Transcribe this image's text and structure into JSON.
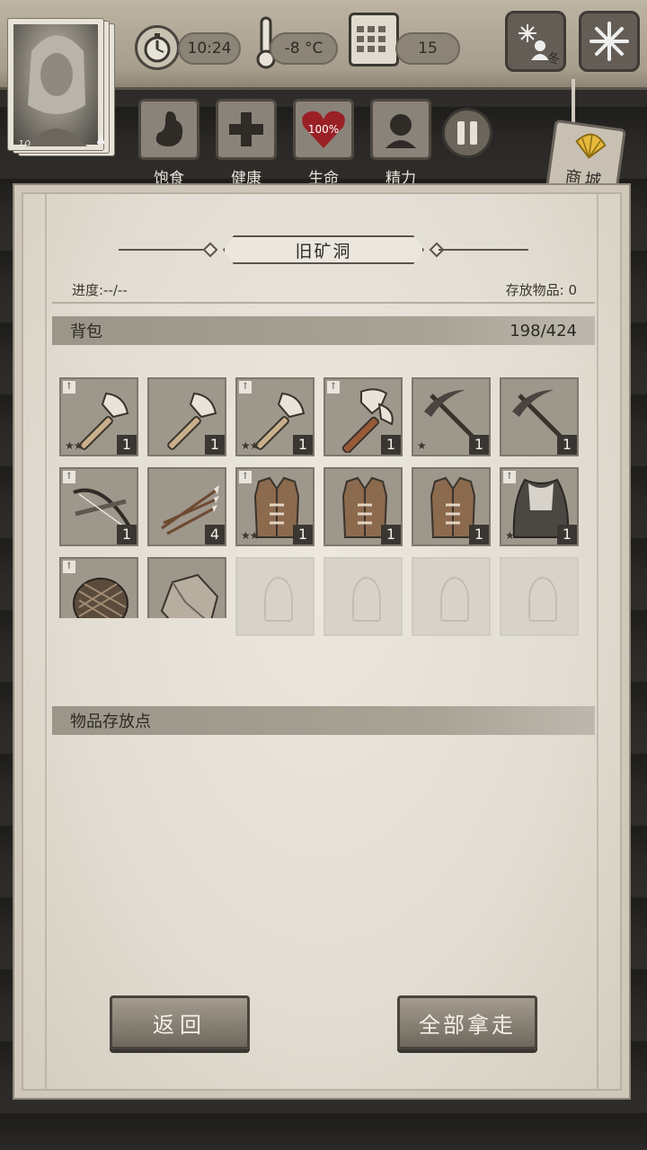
{
  "header": {
    "portrait_level": "10",
    "time": "10:24",
    "temperature": "-8 °C",
    "day": "15",
    "season_label": "冬"
  },
  "status": [
    {
      "label": "饱食",
      "icon": "stomach-icon"
    },
    {
      "label": "健康",
      "icon": "health-cross-icon"
    },
    {
      "label": "生命",
      "icon": "heart-icon",
      "value": "100%"
    },
    {
      "label": "精力",
      "icon": "head-icon"
    }
  ],
  "shop": {
    "label": "商城"
  },
  "panel": {
    "title": "旧矿洞",
    "progress": "进度:--/--",
    "stored_items": "存放物品: 0",
    "backpack": {
      "label": "背包",
      "capacity": "198/424"
    },
    "storage": {
      "label": "物品存放点"
    },
    "items": [
      {
        "name": "axe-icon",
        "count": "1",
        "stars": 2,
        "upgrade": true
      },
      {
        "name": "axe-icon",
        "count": "1",
        "stars": 0,
        "upgrade": false
      },
      {
        "name": "axe-icon",
        "count": "1",
        "stars": 2,
        "upgrade": true
      },
      {
        "name": "hammer-axe-icon",
        "count": "1",
        "stars": 0,
        "upgrade": true
      },
      {
        "name": "pickaxe-icon",
        "count": "1",
        "stars": 1,
        "upgrade": false
      },
      {
        "name": "pickaxe-icon",
        "count": "1",
        "stars": 0,
        "upgrade": false
      },
      {
        "name": "crossbow-icon",
        "count": "1",
        "stars": 0,
        "upgrade": true
      },
      {
        "name": "arrows-icon",
        "count": "4",
        "stars": 0,
        "upgrade": false
      },
      {
        "name": "leather-vest-icon",
        "count": "1",
        "stars": 2,
        "upgrade": true
      },
      {
        "name": "leather-vest-icon",
        "count": "1",
        "stars": 0,
        "upgrade": false
      },
      {
        "name": "leather-vest-icon",
        "count": "1",
        "stars": 0,
        "upgrade": false
      },
      {
        "name": "cloak-icon",
        "count": "1",
        "stars": 1,
        "upgrade": true
      },
      {
        "name": "wicker-basket-icon",
        "count": "",
        "stars": 0,
        "upgrade": true
      },
      {
        "name": "stone-icon",
        "count": "",
        "stars": 0,
        "upgrade": false
      }
    ]
  },
  "buttons": {
    "back": "返回",
    "take_all": "全部拿走"
  }
}
